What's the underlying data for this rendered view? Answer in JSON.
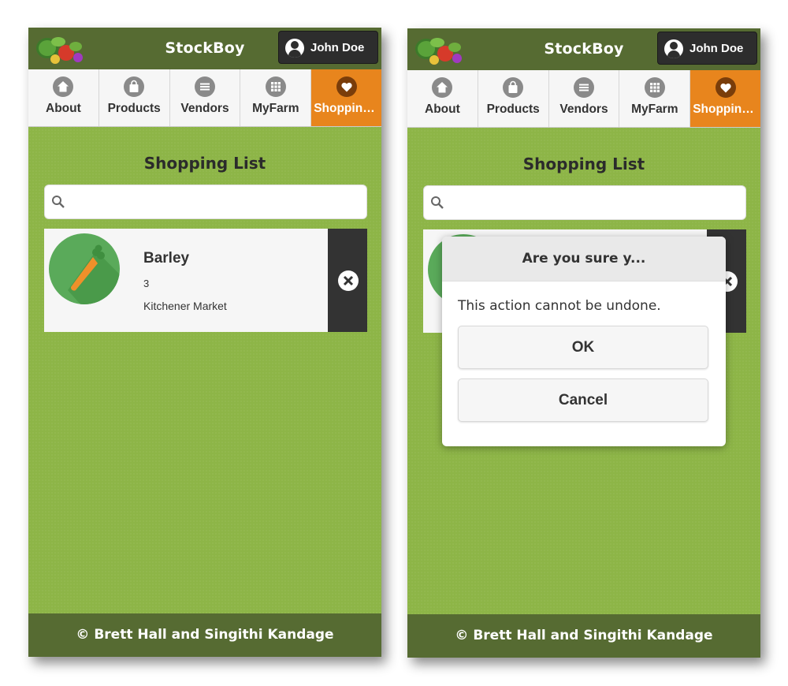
{
  "app": {
    "title": "StockBoy",
    "user_name": "John Doe"
  },
  "nav": [
    {
      "label": "About",
      "icon": "home-icon"
    },
    {
      "label": "Products",
      "icon": "shopping-bag-icon"
    },
    {
      "label": "Vendors",
      "icon": "list-icon"
    },
    {
      "label": "MyFarm",
      "icon": "grid-icon"
    },
    {
      "label": "Shopping List",
      "icon": "heart-icon",
      "active": true
    }
  ],
  "page": {
    "title": "Shopping List",
    "search_placeholder": ""
  },
  "items": [
    {
      "name": "Barley",
      "quantity": "3",
      "vendor": "Kitchener Market",
      "icon": "carrot-icon"
    }
  ],
  "dialog": {
    "title": "Are you sure y...",
    "message": "This action cannot be undone.",
    "ok_label": "OK",
    "cancel_label": "Cancel"
  },
  "footer": {
    "text": "© Brett Hall and Singithi Kandage"
  },
  "colors": {
    "header": "#566b32",
    "background": "#8db547",
    "active_tab": "#e8851d"
  }
}
